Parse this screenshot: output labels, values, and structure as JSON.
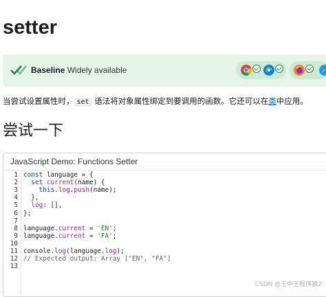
{
  "page": {
    "title": "setter",
    "section_heading": "尝试一下"
  },
  "baseline": {
    "label": "Baseline",
    "status": "Widely available",
    "browser_icons": [
      "chrome-icon",
      "edge-icon",
      "firefox-icon",
      "safari-icon"
    ]
  },
  "description": {
    "part1": "当尝试设置属性时，",
    "code": "set",
    "part2": " 语法将对象属性绑定到要调用的函数。它还可以在",
    "link": "类",
    "part3": "中应用。"
  },
  "demo": {
    "title": "JavaScript Demo: Functions Setter",
    "line_numbers": [
      "1",
      "2",
      "3",
      "4",
      "5",
      "6",
      "7",
      "8",
      "9",
      "10",
      "11",
      "12",
      "13"
    ],
    "lines": [
      "const language = {",
      "  set current(name) {",
      "    this.log.push(name);",
      "  },",
      "  log: [],",
      "};",
      "",
      "language.current = 'EN';",
      "language.current = 'FA';",
      "",
      "console.log(language.log);",
      "// Expected output: Array [\"EN\", \"FA\"]",
      ""
    ]
  },
  "watermark": "CSDN @王中王程序猿2",
  "colors": {
    "baseline_bg": "#e5f6e9",
    "keyword": "#0041a8",
    "property": "#a8209e",
    "string": "#1a7a2f",
    "comment": "#5c6773",
    "link": "#0069c2"
  }
}
